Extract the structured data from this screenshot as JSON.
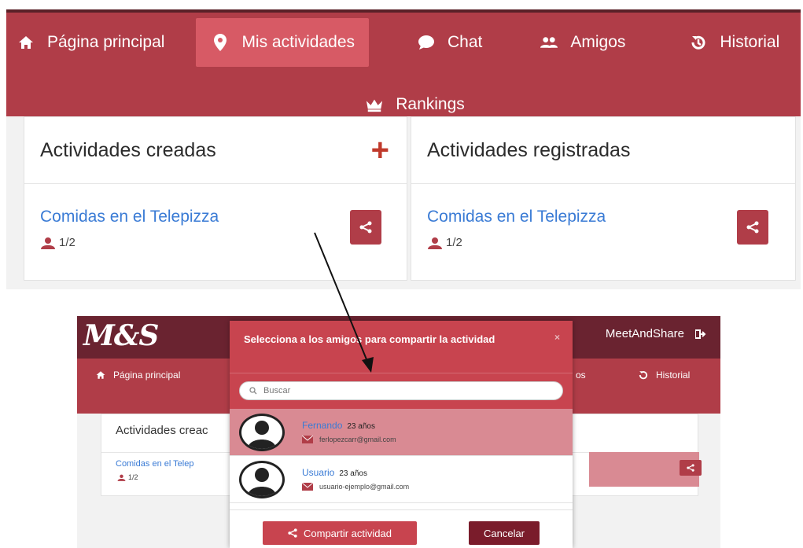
{
  "top": {
    "nav": {
      "items": [
        {
          "label": "Página principal",
          "icon": "home-icon"
        },
        {
          "label": "Mis actividades",
          "icon": "map-pin-icon",
          "active": true
        },
        {
          "label": "Chat",
          "icon": "chat-icon"
        },
        {
          "label": "Amigos",
          "icon": "friends-icon"
        },
        {
          "label": "Historial",
          "icon": "history-icon"
        }
      ],
      "rankings": {
        "label": "Rankings",
        "icon": "crown-icon"
      }
    },
    "created": {
      "title": "Actividades creadas",
      "add_symbol": "+",
      "activity": "Comidas en el Telepizza",
      "count": "1/2"
    },
    "registered": {
      "title": "Actividades registradas",
      "activity": "Comidas en el Telepizza",
      "count": "1/2"
    }
  },
  "bottom": {
    "logo": "M&S",
    "brand": "MeetAndShare",
    "nav": {
      "home": "Página principal",
      "partial": "os",
      "history": "Historial"
    },
    "card": {
      "title": "Actividades creac",
      "activity": "Comidas en el Telep",
      "count": "1/2"
    },
    "modal": {
      "title": "Selecciona a los amigos para compartir la actividad",
      "close": "×",
      "search_placeholder": "Buscar",
      "friends": [
        {
          "name": "Fernando",
          "age": "23 años",
          "email": "ferlopezcarr@gmail.com",
          "selected": true
        },
        {
          "name": "Usuario",
          "age": "23 años",
          "email": "usuario-ejemplo@gmail.com",
          "selected": false
        }
      ],
      "share_button": "Compartir actividad",
      "cancel_button": "Cancelar"
    }
  },
  "colors": {
    "primary": "#b03d48",
    "active": "#d75a65",
    "dark": "#6a2330",
    "link": "#3a7bd5",
    "selected_row": "#d98a93"
  }
}
